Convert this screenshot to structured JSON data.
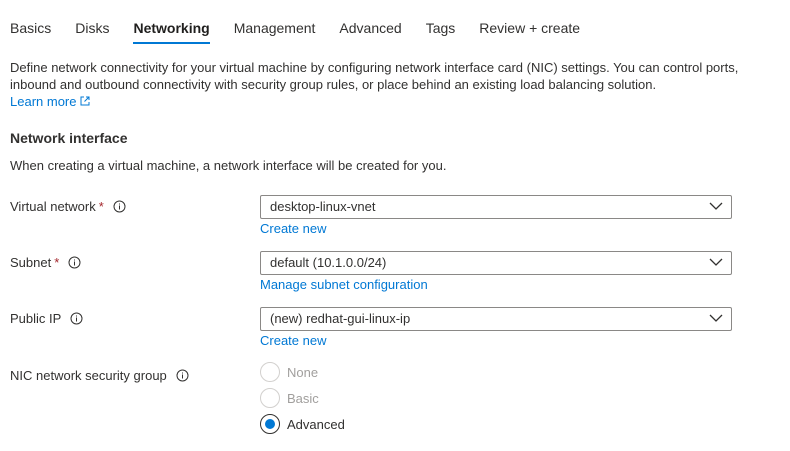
{
  "tabs": [
    {
      "label": "Basics",
      "active": false
    },
    {
      "label": "Disks",
      "active": false
    },
    {
      "label": "Networking",
      "active": true
    },
    {
      "label": "Management",
      "active": false
    },
    {
      "label": "Advanced",
      "active": false
    },
    {
      "label": "Tags",
      "active": false
    },
    {
      "label": "Review + create",
      "active": false
    }
  ],
  "intro": {
    "text": "Define network connectivity for your virtual machine by configuring network interface card (NIC) settings. You can control ports, inbound and outbound connectivity with security group rules, or place behind an existing load balancing solution.",
    "learn_more": "Learn more"
  },
  "section": {
    "title": "Network interface",
    "subtitle": "When creating a virtual machine, a network interface will be created for you."
  },
  "fields": {
    "virtual_network": {
      "label": "Virtual network",
      "required": "*",
      "value": "desktop-linux-vnet",
      "link": "Create new"
    },
    "subnet": {
      "label": "Subnet",
      "required": "*",
      "value": "default (10.1.0.0/24)",
      "link": "Manage subnet configuration"
    },
    "public_ip": {
      "label": "Public IP",
      "value": "(new) redhat-gui-linux-ip",
      "link": "Create new"
    },
    "nic_nsg": {
      "label": "NIC network security group",
      "options": [
        "None",
        "Basic",
        "Advanced"
      ],
      "selected": "Advanced"
    }
  },
  "colors": {
    "accent": "#0078d4",
    "required": "#a4262c",
    "text": "#323130"
  },
  "icons": {
    "info": "info-icon",
    "external": "external-link-icon",
    "dropdown": "chevron-down-icon"
  }
}
